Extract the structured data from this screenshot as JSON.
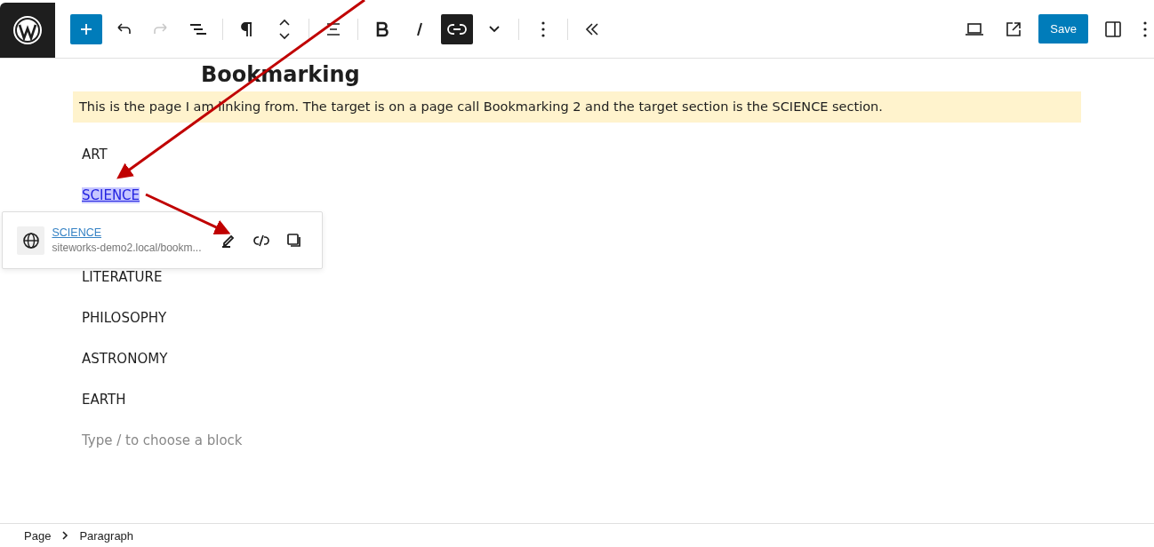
{
  "toolbar": {
    "left": [
      {
        "kind": "add",
        "active": true,
        "disabled": false
      },
      {
        "kind": "undo",
        "active": false,
        "disabled": false
      },
      {
        "kind": "redo",
        "active": false,
        "disabled": true
      },
      {
        "kind": "outline",
        "active": false,
        "disabled": false
      },
      {
        "kind": "sep"
      },
      {
        "kind": "pilcrow",
        "active": false,
        "disabled": false
      },
      {
        "kind": "updown",
        "active": false,
        "disabled": false
      },
      {
        "kind": "sep"
      },
      {
        "kind": "align",
        "active": false,
        "disabled": false
      },
      {
        "kind": "sep"
      },
      {
        "kind": "bold",
        "active": false,
        "disabled": false
      },
      {
        "kind": "italic",
        "active": false,
        "disabled": false
      },
      {
        "kind": "link",
        "active": true,
        "disabled": false
      },
      {
        "kind": "chevron",
        "active": false,
        "disabled": false
      },
      {
        "kind": "sep"
      },
      {
        "kind": "more",
        "active": false,
        "disabled": false
      },
      {
        "kind": "sep"
      },
      {
        "kind": "collapse",
        "active": false,
        "disabled": false
      }
    ],
    "save_label": "Save"
  },
  "page_title": "Bookmarking",
  "intro": "This is the page I am linking from. The target is on a page call Bookmarking 2 and the target section is the SCIENCE section.",
  "items": [
    {
      "kind": "text",
      "text": "ART"
    },
    {
      "kind": "link",
      "text": "SCIENCE",
      "selected": true
    },
    {
      "kind": "hidden"
    },
    {
      "kind": "text",
      "text": "LITERATURE"
    },
    {
      "kind": "text",
      "text": "PHILOSOPHY"
    },
    {
      "kind": "text",
      "text": "ASTRONOMY"
    },
    {
      "kind": "text",
      "text": "EARTH"
    },
    {
      "kind": "placeholder",
      "text": "Type / to choose a block"
    }
  ],
  "link_popover": {
    "title": "SCIENCE",
    "url": "siteworks-demo2.local/bookm..."
  },
  "breadcrumb": [
    "Page",
    "Paragraph"
  ]
}
